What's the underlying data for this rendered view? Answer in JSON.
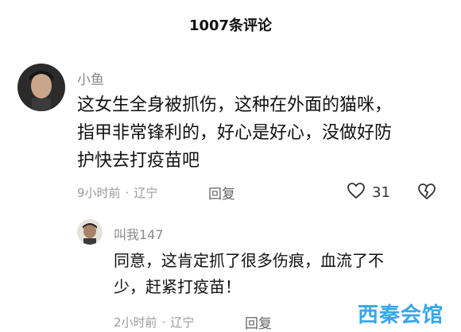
{
  "header": {
    "title": "1007条评论"
  },
  "comments": [
    {
      "username": "小鱼",
      "text_lines": [
        "这女生全身被抓伤，这种在外面的猫咪，",
        "指甲非常锋利的，好心是好心，没做好防",
        "护快去打疫苗吧"
      ],
      "time": "9小时前",
      "location": "辽宁",
      "reply_label": "回复",
      "likes": "31",
      "like_icon": "heart-outline-icon",
      "dislike_icon": "broken-heart-icon"
    },
    {
      "username": "叫我147",
      "text_lines": [
        "同意，这肯定抓了很多伤痕，血流了不",
        "少，赶紧打疫苗！"
      ],
      "time": "2小时前",
      "location": "辽宁",
      "reply_label": "回复"
    }
  ],
  "watermark": {
    "text": "西秦会馆",
    "color": "#36a7e8"
  },
  "meta_separator": "·"
}
